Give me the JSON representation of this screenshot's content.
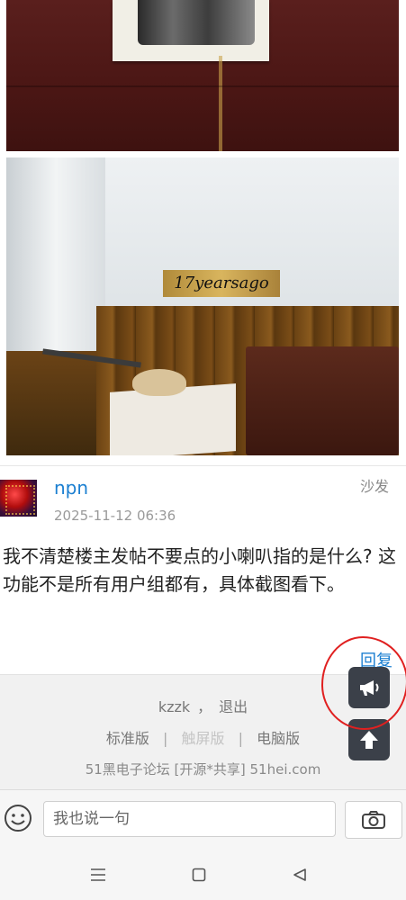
{
  "photos": [
    {
      "name": "phone-repair-photo"
    },
    {
      "name": "desk-corner-photo",
      "sign_text": "17yearsago"
    }
  ],
  "post": {
    "username": "npn",
    "floor_label": "沙发",
    "timestamp": "2025-11-12 06:36",
    "content": "我不清楚楼主发帖不要点的小喇叭指的是什么? 这功能不是所有用户组都有，具体截图看下。",
    "reply_label": "回复"
  },
  "footer": {
    "user": "kzzk",
    "comma": "，",
    "logout": "退出",
    "views": {
      "standard": "标准版",
      "sep1": "|",
      "touch": "触屏版",
      "sep2": "|",
      "desktop": "电脑版"
    },
    "site_name": "51黑电子论坛 [开源*共享] 51hei.com"
  },
  "fabs": {
    "announce_icon": "megaphone-icon",
    "top_icon": "arrow-up-icon"
  },
  "annotation": {
    "color": "#e02020"
  },
  "input_bar": {
    "placeholder": "我也说一句",
    "emoji_icon": "smiley-icon",
    "camera_icon": "camera-icon"
  },
  "nav": {
    "menu_icon": "menu-icon",
    "home_icon": "home-square-icon",
    "back_icon": "back-triangle-icon"
  },
  "colors": {
    "link": "#1b7fd1",
    "fab": "#3b4049"
  }
}
